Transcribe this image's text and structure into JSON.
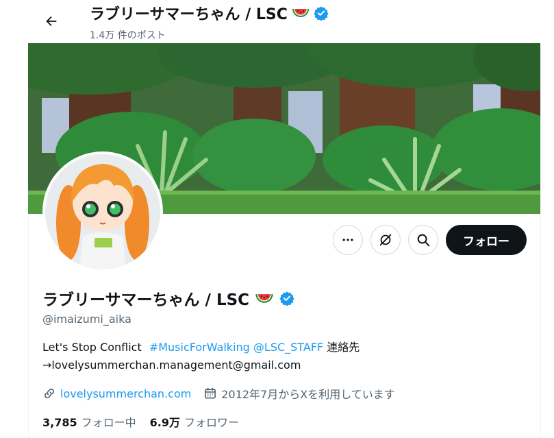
{
  "header": {
    "title": "ラブリーサマーちゃん / LSC",
    "post_count": "1.4万 件のポスト",
    "back_icon": "arrow-left-icon"
  },
  "profile": {
    "display_name": "ラブリーサマーちゃん / LSC",
    "handle": "@imaizumi_aika",
    "bio_text": "Let's Stop Conflict",
    "bio_hashtag": "#MusicForWalking",
    "bio_mention": "@LSC_STAFF",
    "bio_contact_label": "連絡先",
    "bio_email": "→lovelysummerchan.management@gmail.com",
    "website": "lovelysummerchan.com",
    "joined": "2012年7月からXを利用しています",
    "following_count": "3,785",
    "following_label": "フォロー中",
    "followers_count": "6.9万",
    "followers_label": "フォロワー"
  },
  "actions": {
    "more_icon": "more-horizontal-icon",
    "notify_icon": "no-signal-icon",
    "search_icon": "search-icon",
    "follow_label": "フォロー"
  },
  "colors": {
    "accent": "#1d9bf0",
    "verified": "#1d9bf0",
    "text": "#0f1419",
    "muted": "#536471",
    "follow_bg": "#0f1419"
  }
}
